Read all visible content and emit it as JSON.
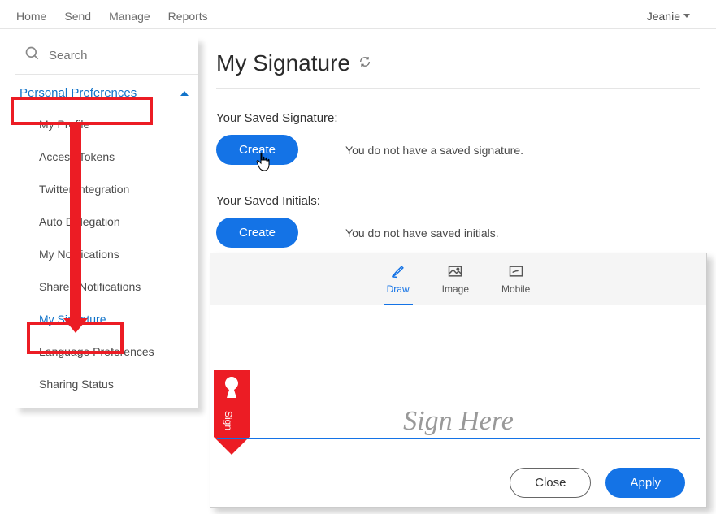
{
  "topnav": {
    "items": [
      "Home",
      "Send",
      "Manage",
      "Reports"
    ],
    "user": "Jeanie"
  },
  "sidebar": {
    "search_placeholder": "Search",
    "group_label": "Personal Preferences",
    "items": [
      {
        "label": "My Profile"
      },
      {
        "label": "Access Tokens"
      },
      {
        "label": "Twitter Integration"
      },
      {
        "label": "Auto Delegation"
      },
      {
        "label": "My Notifications"
      },
      {
        "label": "Shared Notifications"
      },
      {
        "label": "My Signature"
      },
      {
        "label": "Language Preferences"
      },
      {
        "label": "Sharing Status"
      }
    ]
  },
  "content": {
    "heading": "My Signature",
    "signature": {
      "label": "Your Saved Signature:",
      "button": "Create",
      "status": "You do not have a saved signature."
    },
    "initials": {
      "label": "Your Saved Initials:",
      "button": "Create",
      "status": "You do not have saved initials."
    }
  },
  "modal": {
    "tabs": {
      "draw": "Draw",
      "image": "Image",
      "mobile": "Mobile"
    },
    "placeholder": "Sign Here",
    "bookmark": "Sign",
    "close": "Close",
    "apply": "Apply"
  }
}
